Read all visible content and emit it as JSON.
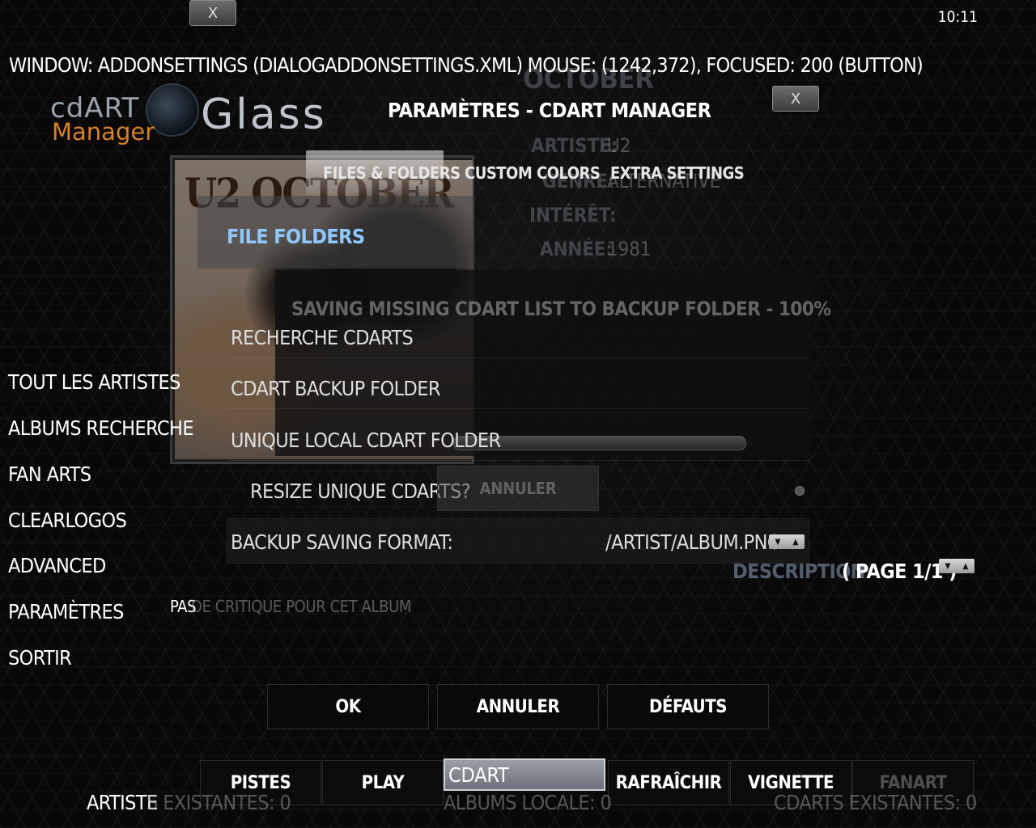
{
  "header": {
    "clock": "10:11",
    "debug": "WINDOW: ADDONSETTINGS (DIALOGADDONSETTINGS.XML)  MOUSE: (1242,372), FOCUSED: 200 (BUTTON)",
    "close_label": "X"
  },
  "logo": {
    "top": "cdART",
    "bottom": "Manager",
    "glass": "Glass"
  },
  "album": {
    "cover_text": "U2 OCTOBER",
    "title": "OCTOBER",
    "artist_label": "ARTISTE:",
    "artist_value": "U2",
    "genre_label": "GENRE:",
    "genre_value": "ALTERNATIVE",
    "interest_label": "INTÉRÊT:",
    "year_label": "ANNÉE:",
    "year_value": "1981"
  },
  "menu": {
    "items": [
      "TOUT LES ARTISTES",
      "ALBUMS RECHERCHE",
      "FAN ARTS",
      "CLEARLOGOS",
      "ADVANCED",
      "PARAMÈTRES",
      "SORTIR"
    ]
  },
  "dialog": {
    "title": "PARAMÈTRES - CDART MANAGER",
    "tabs": [
      "FILES & FOLDERS",
      "CUSTOM COLORS",
      "EXTRA SETTINGS"
    ],
    "section": "FILE FOLDERS",
    "progress_text": "SAVING MISSING CDART LIST TO BACKUP FOLDER - 100%",
    "rows": [
      "RECHERCHE CDARTS",
      "CDART  BACKUP FOLDER",
      "UNIQUE LOCAL CDART FOLDER"
    ],
    "resize_label": "RESIZE UNIQUE CDARTS?",
    "ghost_cancel": "ANNULER",
    "format_label": "BACKUP SAVING FORMAT:",
    "format_value": "/ARTIST/ALBUM.PNG",
    "ok": "OK",
    "cancel": "ANNULER",
    "defaults": "DÉFAUTS"
  },
  "description": {
    "label": "DESCRIPTION",
    "page": "( PAGE 1/1 )",
    "review_prefix": "PAS",
    "review_rest": " DE CRITIQUE POUR CET ALBUM"
  },
  "bottom": {
    "buttons": [
      "PISTES",
      "PLAY",
      "CDART",
      "RAFRAîCHIR",
      "VIGNETTE",
      "FANART"
    ],
    "status_artist_a": "ARTISTE",
    "status_artist_b": "S EXISTANTES: 0",
    "status_albums": "ALBUMS LOCALE: 0",
    "status_cdarts": "CDARTS EXISTANTES: 0"
  },
  "colors": {
    "accent": "#8fc8ff",
    "logo_orange": "#d8812a"
  }
}
